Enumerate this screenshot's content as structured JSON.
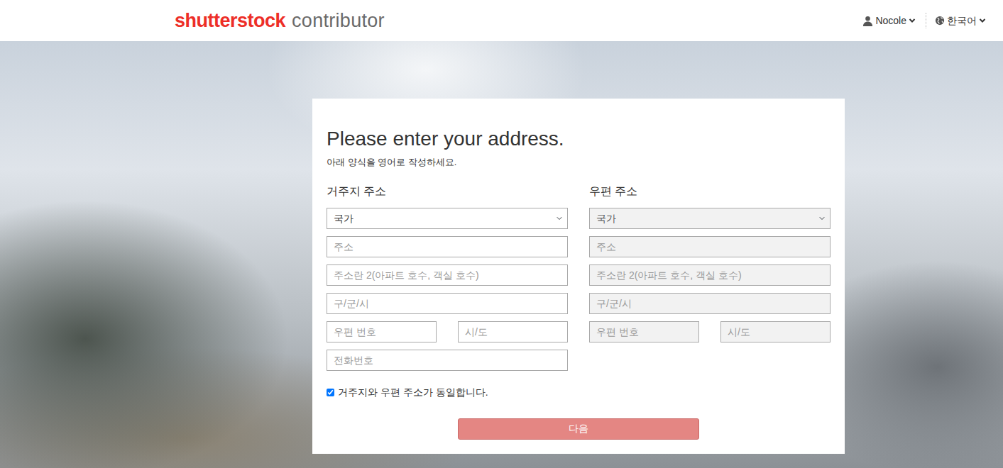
{
  "header": {
    "logo": {
      "brand": "shutterstock",
      "product": "contributor"
    },
    "user_menu": {
      "label": "Nocole"
    },
    "language_menu": {
      "label": "한국어"
    }
  },
  "form": {
    "title": "Please enter your address.",
    "subtitle": "아래 양식을 영어로 작성하세요.",
    "residential": {
      "heading": "거주지 주소",
      "disabled": false,
      "country": "국가",
      "address": "주소",
      "address2": "주소란 2(아파트 호수, 객실 호수)",
      "city": "구/군/시",
      "postal_code": "우편 번호",
      "state": "시/도",
      "phone": "전화번호"
    },
    "mailing": {
      "heading": "우편 주소",
      "disabled": true,
      "country": "국가",
      "address": "주소",
      "address2": "주소란 2(아파트 호수, 객실 호수)",
      "city": "구/군/시",
      "postal_code": "우편 번호",
      "state": "시/도"
    },
    "same_address": {
      "label": "거주지와 우편 주소가 동일합니다.",
      "checked": true
    },
    "next_button": {
      "label": "다음",
      "disabled": true
    }
  }
}
